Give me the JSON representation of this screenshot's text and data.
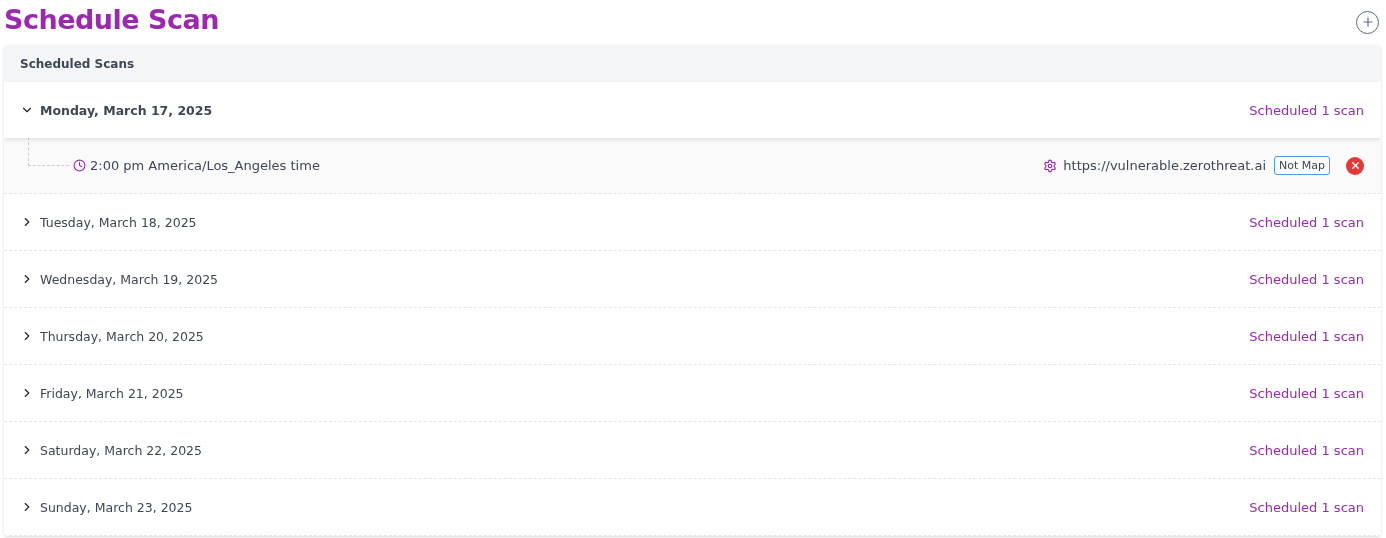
{
  "title": "Schedule Scan",
  "panel": {
    "heading": "Scheduled Scans",
    "days": [
      {
        "date": "Monday, March 17, 2025",
        "expanded": true,
        "summary": "Scheduled 1 scan",
        "scans": [
          {
            "time": "2:00 pm America/Los_Angeles time",
            "url": "https://vulnerable.zerothreat.ai",
            "tag": "Not Map"
          }
        ]
      },
      {
        "date": "Tuesday, March 18, 2025",
        "expanded": false,
        "summary": "Scheduled 1 scan"
      },
      {
        "date": "Wednesday, March 19, 2025",
        "expanded": false,
        "summary": "Scheduled 1 scan"
      },
      {
        "date": "Thursday, March 20, 2025",
        "expanded": false,
        "summary": "Scheduled 1 scan"
      },
      {
        "date": "Friday, March 21, 2025",
        "expanded": false,
        "summary": "Scheduled 1 scan"
      },
      {
        "date": "Saturday, March 22, 2025",
        "expanded": false,
        "summary": "Scheduled 1 scan"
      },
      {
        "date": "Sunday, March 23, 2025",
        "expanded": false,
        "summary": "Scheduled 1 scan"
      }
    ]
  }
}
